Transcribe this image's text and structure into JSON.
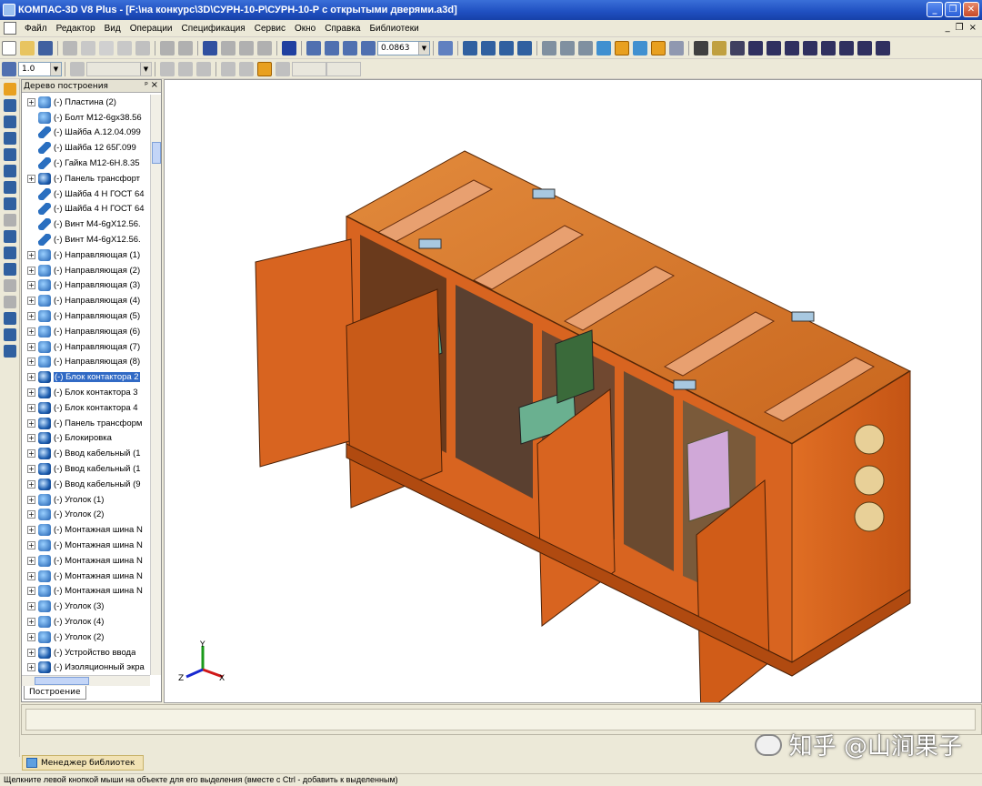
{
  "window": {
    "title": "КОМПАС-3D V8 Plus - [F:\\на конкурс\\3D\\СУРН-10-Р\\СУРН-10-Р  с открытыми дверями.a3d]"
  },
  "menu": [
    "Файл",
    "Редактор",
    "Вид",
    "Операции",
    "Спецификация",
    "Сервис",
    "Окно",
    "Справка",
    "Библиотеки"
  ],
  "toolbar": {
    "zoom_value": "0.0863",
    "step_value": "1.0"
  },
  "tree_panel": {
    "title": "Дерево построения",
    "tab_label": "Построение",
    "items": [
      {
        "label": "(-) Пластина (2)",
        "icon": "part-icon",
        "expand": true
      },
      {
        "label": "(-) Болт М12-6gx38.56",
        "icon": "part-icon",
        "expand": false
      },
      {
        "label": "(-) Шайба А.12.04.099",
        "icon": "wrench-icon",
        "expand": false
      },
      {
        "label": "(-) Шайба 12 65Г.099",
        "icon": "wrench-icon",
        "expand": false
      },
      {
        "label": "(-) Гайка  М12-6Н.8.35",
        "icon": "wrench-icon",
        "expand": false
      },
      {
        "label": "(-) Панель трансфорт",
        "icon": "assembly-icon",
        "expand": true
      },
      {
        "label": "(-) Шайба 4 Н ГОСТ 64",
        "icon": "wrench-icon",
        "expand": false
      },
      {
        "label": "(-) Шайба 4 Н ГОСТ 64",
        "icon": "wrench-icon",
        "expand": false
      },
      {
        "label": "(-) Винт М4-6gX12.56.",
        "icon": "wrench-icon",
        "expand": false
      },
      {
        "label": "(-) Винт М4-6gX12.56.",
        "icon": "wrench-icon",
        "expand": false
      },
      {
        "label": "(-) Направляющая (1)",
        "icon": "part-icon",
        "expand": true
      },
      {
        "label": "(-) Направляющая (2)",
        "icon": "part-icon",
        "expand": true
      },
      {
        "label": "(-) Направляющая (3)",
        "icon": "part-icon",
        "expand": true
      },
      {
        "label": "(-) Направляющая (4)",
        "icon": "part-icon",
        "expand": true
      },
      {
        "label": "(-) Направляющая (5)",
        "icon": "part-icon",
        "expand": true
      },
      {
        "label": "(-) Направляющая (6)",
        "icon": "part-icon",
        "expand": true
      },
      {
        "label": "(-) Направляющая (7)",
        "icon": "part-icon",
        "expand": true
      },
      {
        "label": "(-) Направляющая (8)",
        "icon": "part-icon",
        "expand": true
      },
      {
        "label": "(-) Блок контактора 2",
        "icon": "assembly-icon",
        "expand": true,
        "selected": true
      },
      {
        "label": "(-) Блок контактора 3",
        "icon": "assembly-icon",
        "expand": true
      },
      {
        "label": "(-) Блок контактора 4",
        "icon": "assembly-icon",
        "expand": true
      },
      {
        "label": "(-) Панель трансформ",
        "icon": "assembly-icon",
        "expand": true
      },
      {
        "label": "(-) Блокировка",
        "icon": "assembly-icon",
        "expand": true
      },
      {
        "label": "(-) Ввод кабельный (1",
        "icon": "assembly-icon",
        "expand": true
      },
      {
        "label": "(-) Ввод кабельный (1",
        "icon": "assembly-icon",
        "expand": true
      },
      {
        "label": "(-) Ввод кабельный (9",
        "icon": "assembly-icon",
        "expand": true
      },
      {
        "label": "(-) Уголок (1)",
        "icon": "part-icon",
        "expand": true
      },
      {
        "label": "(-) Уголок (2)",
        "icon": "part-icon",
        "expand": true
      },
      {
        "label": "(-) Монтажная шина N",
        "icon": "part-icon",
        "expand": true
      },
      {
        "label": "(-) Монтажная шина N",
        "icon": "part-icon",
        "expand": true
      },
      {
        "label": "(-) Монтажная шина N",
        "icon": "part-icon",
        "expand": true
      },
      {
        "label": "(-) Монтажная шина N",
        "icon": "part-icon",
        "expand": true
      },
      {
        "label": "(-) Монтажная шина N",
        "icon": "part-icon",
        "expand": true
      },
      {
        "label": "(-) Уголок (3)",
        "icon": "part-icon",
        "expand": true
      },
      {
        "label": "(-) Уголок (4)",
        "icon": "part-icon",
        "expand": true
      },
      {
        "label": "(-) Уголок (2)",
        "icon": "part-icon",
        "expand": true
      },
      {
        "label": "(-) Устройство ввода",
        "icon": "assembly-icon",
        "expand": true
      },
      {
        "label": "(-) Изоляционный экра",
        "icon": "assembly-icon",
        "expand": true
      }
    ]
  },
  "viewport": {
    "axis_labels": {
      "y": "Y",
      "z": "Z",
      "x": "X"
    }
  },
  "library_manager": {
    "label": "Менеджер библиотек"
  },
  "status_bar": {
    "text": "Щелкните левой кнопкой мыши на объекте для его выделения (вместе с Ctrl - добавить к выделенным)"
  },
  "watermark": {
    "text": "知乎 @山涧果子"
  },
  "colors": {
    "title_blue": "#1f4fc0",
    "selection": "#316ac5",
    "cabinet_orange": "#e06a1c"
  }
}
